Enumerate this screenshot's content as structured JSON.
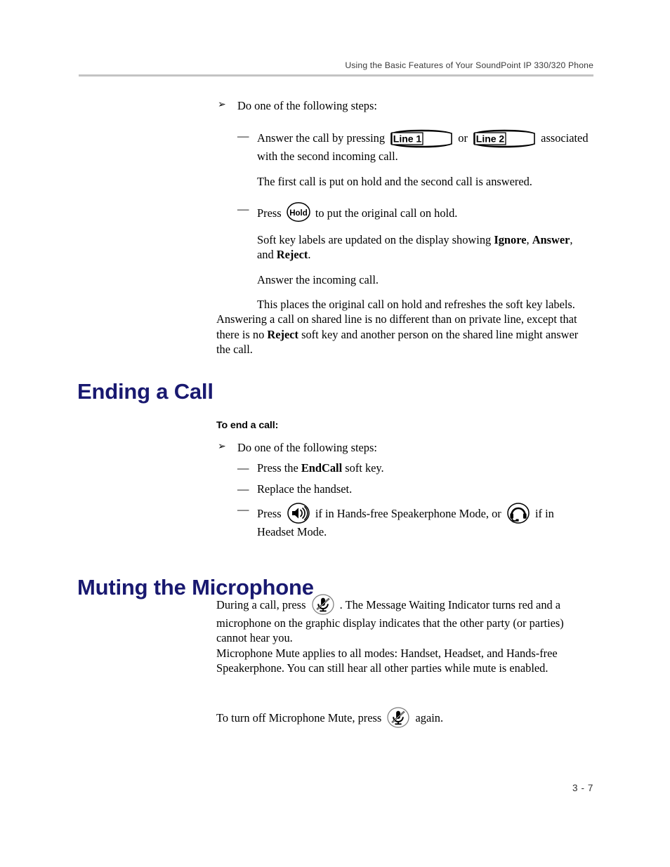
{
  "header": {
    "running_title": "Using the Basic Features of Your SoundPoint IP 330/320 Phone"
  },
  "footer": {
    "page_number": "3 - 7"
  },
  "colors": {
    "heading": "#191970",
    "rule": "#c3c3c3",
    "header_text": "#3a3a3a",
    "body_text": "#000000"
  },
  "glyphs": {
    "arrow_bullet": "➢",
    "dash_bullet": "—"
  },
  "keys": {
    "line1_label": "Line 1",
    "line2_label": "Line 2",
    "hold_label": "Hold"
  },
  "section_answering": {
    "step_intro": "Do one of the following steps:",
    "step1_pre": "Answer the call by pressing",
    "step1_mid": "or",
    "step1_post": "associated with the second incoming call.",
    "step1_result": "The first call is put on hold and the second call is answered.",
    "step2_pre": "Press",
    "step2_post": "to put the original call on hold.",
    "step2_result_pre": "Soft key labels are updated on the display showing",
    "step2_softkey1": "Ignore",
    "step2_softkey2": "Answer",
    "step2_conj": ", and",
    "step2_softkey3": "Reject",
    "step2_result_end": ".",
    "step2_line2": "Answer the incoming call.",
    "step2_line3": "This places the original call on hold and refreshes the soft key labels.",
    "closing_pre": "Answering a call on shared line is no different than on private line, except that there is no",
    "closing_bold": "Reject",
    "closing_post": "soft key and another person on the shared line might answer the call."
  },
  "section_ending_call": {
    "heading": "Ending a Call",
    "subheading": "To end a call:",
    "step_intro": "Do one of the following steps:",
    "item1_pre": "Press the",
    "item1_bold": "EndCall",
    "item1_post": "soft key.",
    "item2": "Replace the handset.",
    "item3_pre": "Press",
    "item3_mid": "if in Hands-free Speakerphone Mode, or",
    "item3_post": "if in Headset Mode."
  },
  "section_muting": {
    "heading": "Muting the Microphone",
    "para1_pre": "During a call, press",
    "para1_post": ". The Message Waiting Indicator turns red and a microphone on the graphic display indicates that the other party (or parties) cannot hear you.",
    "para2": "Microphone Mute applies to all modes: Handset, Headset, and Hands-free Speakerphone. You can still hear all other parties while mute is enabled.",
    "para3_pre": "To turn off Microphone Mute, press",
    "para3_post": "again."
  },
  "icons": {
    "speaker": "speakerphone-icon",
    "headset": "headset-icon",
    "mute": "mute-microphone-icon"
  }
}
